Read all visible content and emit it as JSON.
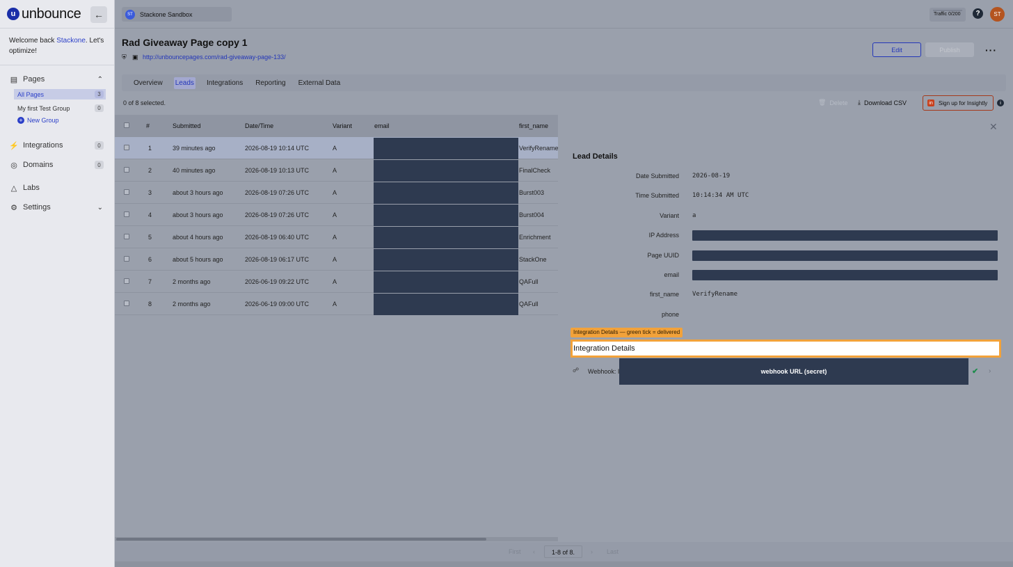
{
  "brand": {
    "logo_text": "unbounce",
    "logo_mark": "u"
  },
  "sidebar": {
    "welcome_prefix": "Welcome back ",
    "welcome_name": "Stackone",
    "welcome_suffix": ". Let's optimize!",
    "pages_label": "Pages",
    "groups": [
      {
        "label": "All Pages",
        "count": "3"
      },
      {
        "label": "My first Test Group",
        "count": "0"
      }
    ],
    "new_group_label": "New Group",
    "items": [
      {
        "label": "Integrations",
        "count": "0",
        "icon": "plug-icon"
      },
      {
        "label": "Domains",
        "count": "0",
        "icon": "globe-icon"
      },
      {
        "label": "Labs",
        "icon": "flask-icon"
      },
      {
        "label": "Settings",
        "icon": "gear-icon"
      }
    ]
  },
  "topbar": {
    "workspace_initials": "ST",
    "workspace_name": "Stackone Sandbox",
    "traffic_label": "Traffic",
    "traffic_value": "0/200",
    "traffic_fill": 0,
    "user_initials": "ST"
  },
  "page": {
    "title": "Rad Giveaway Page copy 1",
    "url": "http://unbouncepages.com/rad-giveaway-page-133/",
    "edit_label": "Edit",
    "publish_label": "Publish",
    "tabs": [
      "Overview",
      "Leads",
      "Integrations",
      "Reporting",
      "External Data"
    ],
    "active_tab": "Leads"
  },
  "toolbar": {
    "selected_text": "0 of 8 selected.",
    "delete_label": "Delete",
    "download_label": "Download CSV",
    "insightly_label": "Sign up for Insightly"
  },
  "table": {
    "columns": [
      "#",
      "Submitted",
      "Date/Time",
      "Variant",
      "email",
      "first_name"
    ],
    "rows": [
      {
        "n": "1",
        "submitted": "39 minutes ago",
        "datetime": "2026-08-19 10:14 UTC",
        "variant": "A",
        "first_name": "VerifyRename",
        "selected": true
      },
      {
        "n": "2",
        "submitted": "40 minutes ago",
        "datetime": "2026-08-19 10:13 UTC",
        "variant": "A",
        "first_name": "FinalCheck"
      },
      {
        "n": "3",
        "submitted": "about 3 hours ago",
        "datetime": "2026-08-19 07:26 UTC",
        "variant": "A",
        "first_name": "Burst003"
      },
      {
        "n": "4",
        "submitted": "about 3 hours ago",
        "datetime": "2026-08-19 07:26 UTC",
        "variant": "A",
        "first_name": "Burst004"
      },
      {
        "n": "5",
        "submitted": "about 4 hours ago",
        "datetime": "2026-08-19 06:40 UTC",
        "variant": "A",
        "first_name": "Enrichment"
      },
      {
        "n": "6",
        "submitted": "about 5 hours ago",
        "datetime": "2026-08-19 06:17 UTC",
        "variant": "A",
        "first_name": "StackOne"
      },
      {
        "n": "7",
        "submitted": "2 months ago",
        "datetime": "2026-06-19 09:22 UTC",
        "variant": "A",
        "first_name": "QAFull"
      },
      {
        "n": "8",
        "submitted": "2 months ago",
        "datetime": "2026-06-19 09:00 UTC",
        "variant": "A",
        "first_name": "QAFull"
      }
    ]
  },
  "pager": {
    "first": "First",
    "prev": "‹",
    "range": "1-8 of 8.",
    "next": "›",
    "last": "Last"
  },
  "lead": {
    "title": "Lead Details",
    "fields": [
      {
        "label": "Date Submitted",
        "value": "2026-08-19"
      },
      {
        "label": "Time Submitted",
        "value": "10:14:34 AM UTC"
      },
      {
        "label": "Variant",
        "value": "a"
      },
      {
        "label": "IP Address",
        "redacted": true
      },
      {
        "label": "Page UUID",
        "redacted": true
      },
      {
        "label": "email",
        "redacted": true
      },
      {
        "label": "first_name",
        "value": "VerifyRename"
      },
      {
        "label": "phone",
        "value": ""
      }
    ],
    "hint": "Integration Details — green tick = delivered",
    "integration_title": "Integration Details",
    "webhook_label": "Webhook: I",
    "webhook_redacted_label": "webhook URL (secret)"
  }
}
